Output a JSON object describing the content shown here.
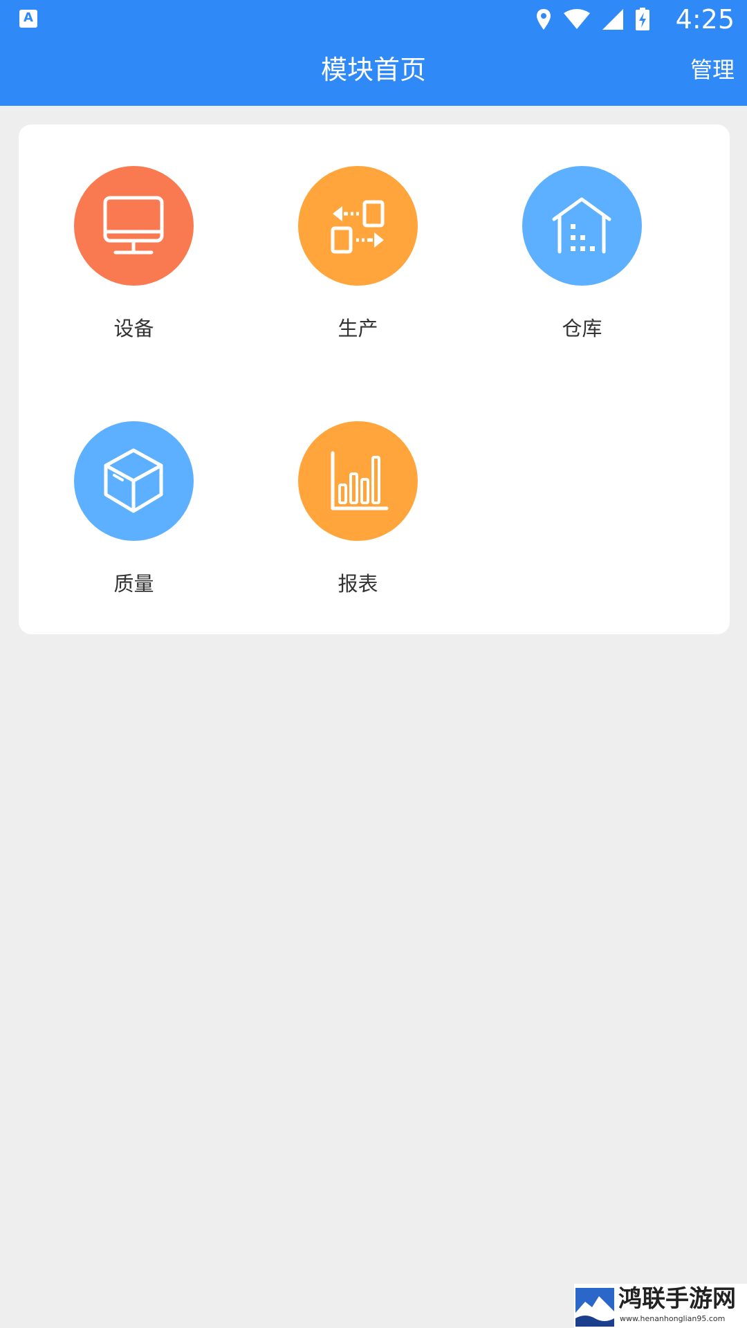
{
  "status_bar": {
    "time": "4:25",
    "app_icon_letter": "A",
    "icons": [
      "location-icon",
      "wifi-icon",
      "signal-icon",
      "battery-charging-icon"
    ]
  },
  "app_bar": {
    "title": "模块首页",
    "manage_label": "管理",
    "background": "#2f8af7"
  },
  "modules": [
    {
      "label": "设备",
      "icon": "monitor-icon",
      "color": "#f97a50"
    },
    {
      "label": "生产",
      "icon": "transfer-icon",
      "color": "#ffa53b"
    },
    {
      "label": "仓库",
      "icon": "warehouse-icon",
      "color": "#5cb0ff"
    },
    {
      "label": "质量",
      "icon": "box-icon",
      "color": "#5cb0ff"
    },
    {
      "label": "报表",
      "icon": "bar-chart-icon",
      "color": "#ffa53b"
    }
  ],
  "watermark": {
    "title": "鸿联手游网",
    "url": "www.henanhonglian95.com"
  }
}
